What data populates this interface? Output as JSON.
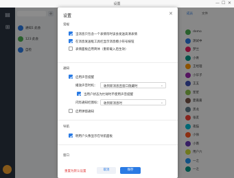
{
  "window": {
    "title": "设置",
    "controls": [
      "—",
      "☐",
      "✕"
    ]
  },
  "chat_list": {
    "items": [
      {
        "label": "通知1 此会",
        "color": "#2a7be4"
      },
      {
        "label": "123 此会",
        "color": "#4caf50"
      },
      {
        "label": "自检",
        "color": "#2a7be4"
      }
    ]
  },
  "members": {
    "tabs": [
      "成员",
      "文件"
    ],
    "users": [
      {
        "name": "demo",
        "color": "#4caf50"
      },
      {
        "name": "测试中",
        "color": "#2a7be4"
      },
      {
        "name": "梦兰",
        "color": "#e91e63"
      },
      {
        "name": "小青",
        "color": "#009688"
      },
      {
        "name": "王经理",
        "color": "#ff9800"
      },
      {
        "name": "小华子",
        "color": "#9c27b0"
      },
      {
        "name": "王五",
        "color": "#3f51b5"
      },
      {
        "name": "星星",
        "color": "#8bc34a"
      },
      {
        "name": "夏嘉嘉",
        "color": "#795548"
      },
      {
        "name": "黑龙",
        "color": "#607d8b"
      },
      {
        "name": "张友",
        "color": "#f44336"
      },
      {
        "name": "夜猫",
        "color": "#00bcd4"
      },
      {
        "name": "小徐",
        "color": "#ff5722"
      },
      {
        "name": "小南",
        "color": "#673ab7"
      },
      {
        "name": "用户六",
        "color": "#cddc39"
      },
      {
        "name": "一之",
        "color": "#2196f3"
      },
      {
        "name": "一之",
        "color": "#009688"
      }
    ]
  },
  "dialog": {
    "title": "设置",
    "close": "✕",
    "sections": {
      "appearance": "常规",
      "notify": "通知",
      "nav": "导航",
      "window": "窗口"
    },
    "options": {
      "opt1": "当消息只包含一个表情符时该会发送高清表情",
      "opt2": "在消息发送框工具栏显示消息模小符号按钮",
      "opt3": "表情面板启用简体（重新载入后生效）",
      "sound": "启用声音提醒",
      "sound_time_label": "播放声音时机：",
      "sound_time_value": "收到新消息且窗口隐藏时",
      "mute_when_focused": "当用户状态为忙碌时不使用声音提醒",
      "flash_label": "闪烁通知栏图标：",
      "flash_value": "收到新消息时",
      "popup": "启用弹窗通知",
      "nav_opt": "明用户头像显示在导航面板"
    },
    "footer": {
      "reset": "重置为默认设置",
      "cancel": "取消",
      "save": "保存"
    }
  }
}
